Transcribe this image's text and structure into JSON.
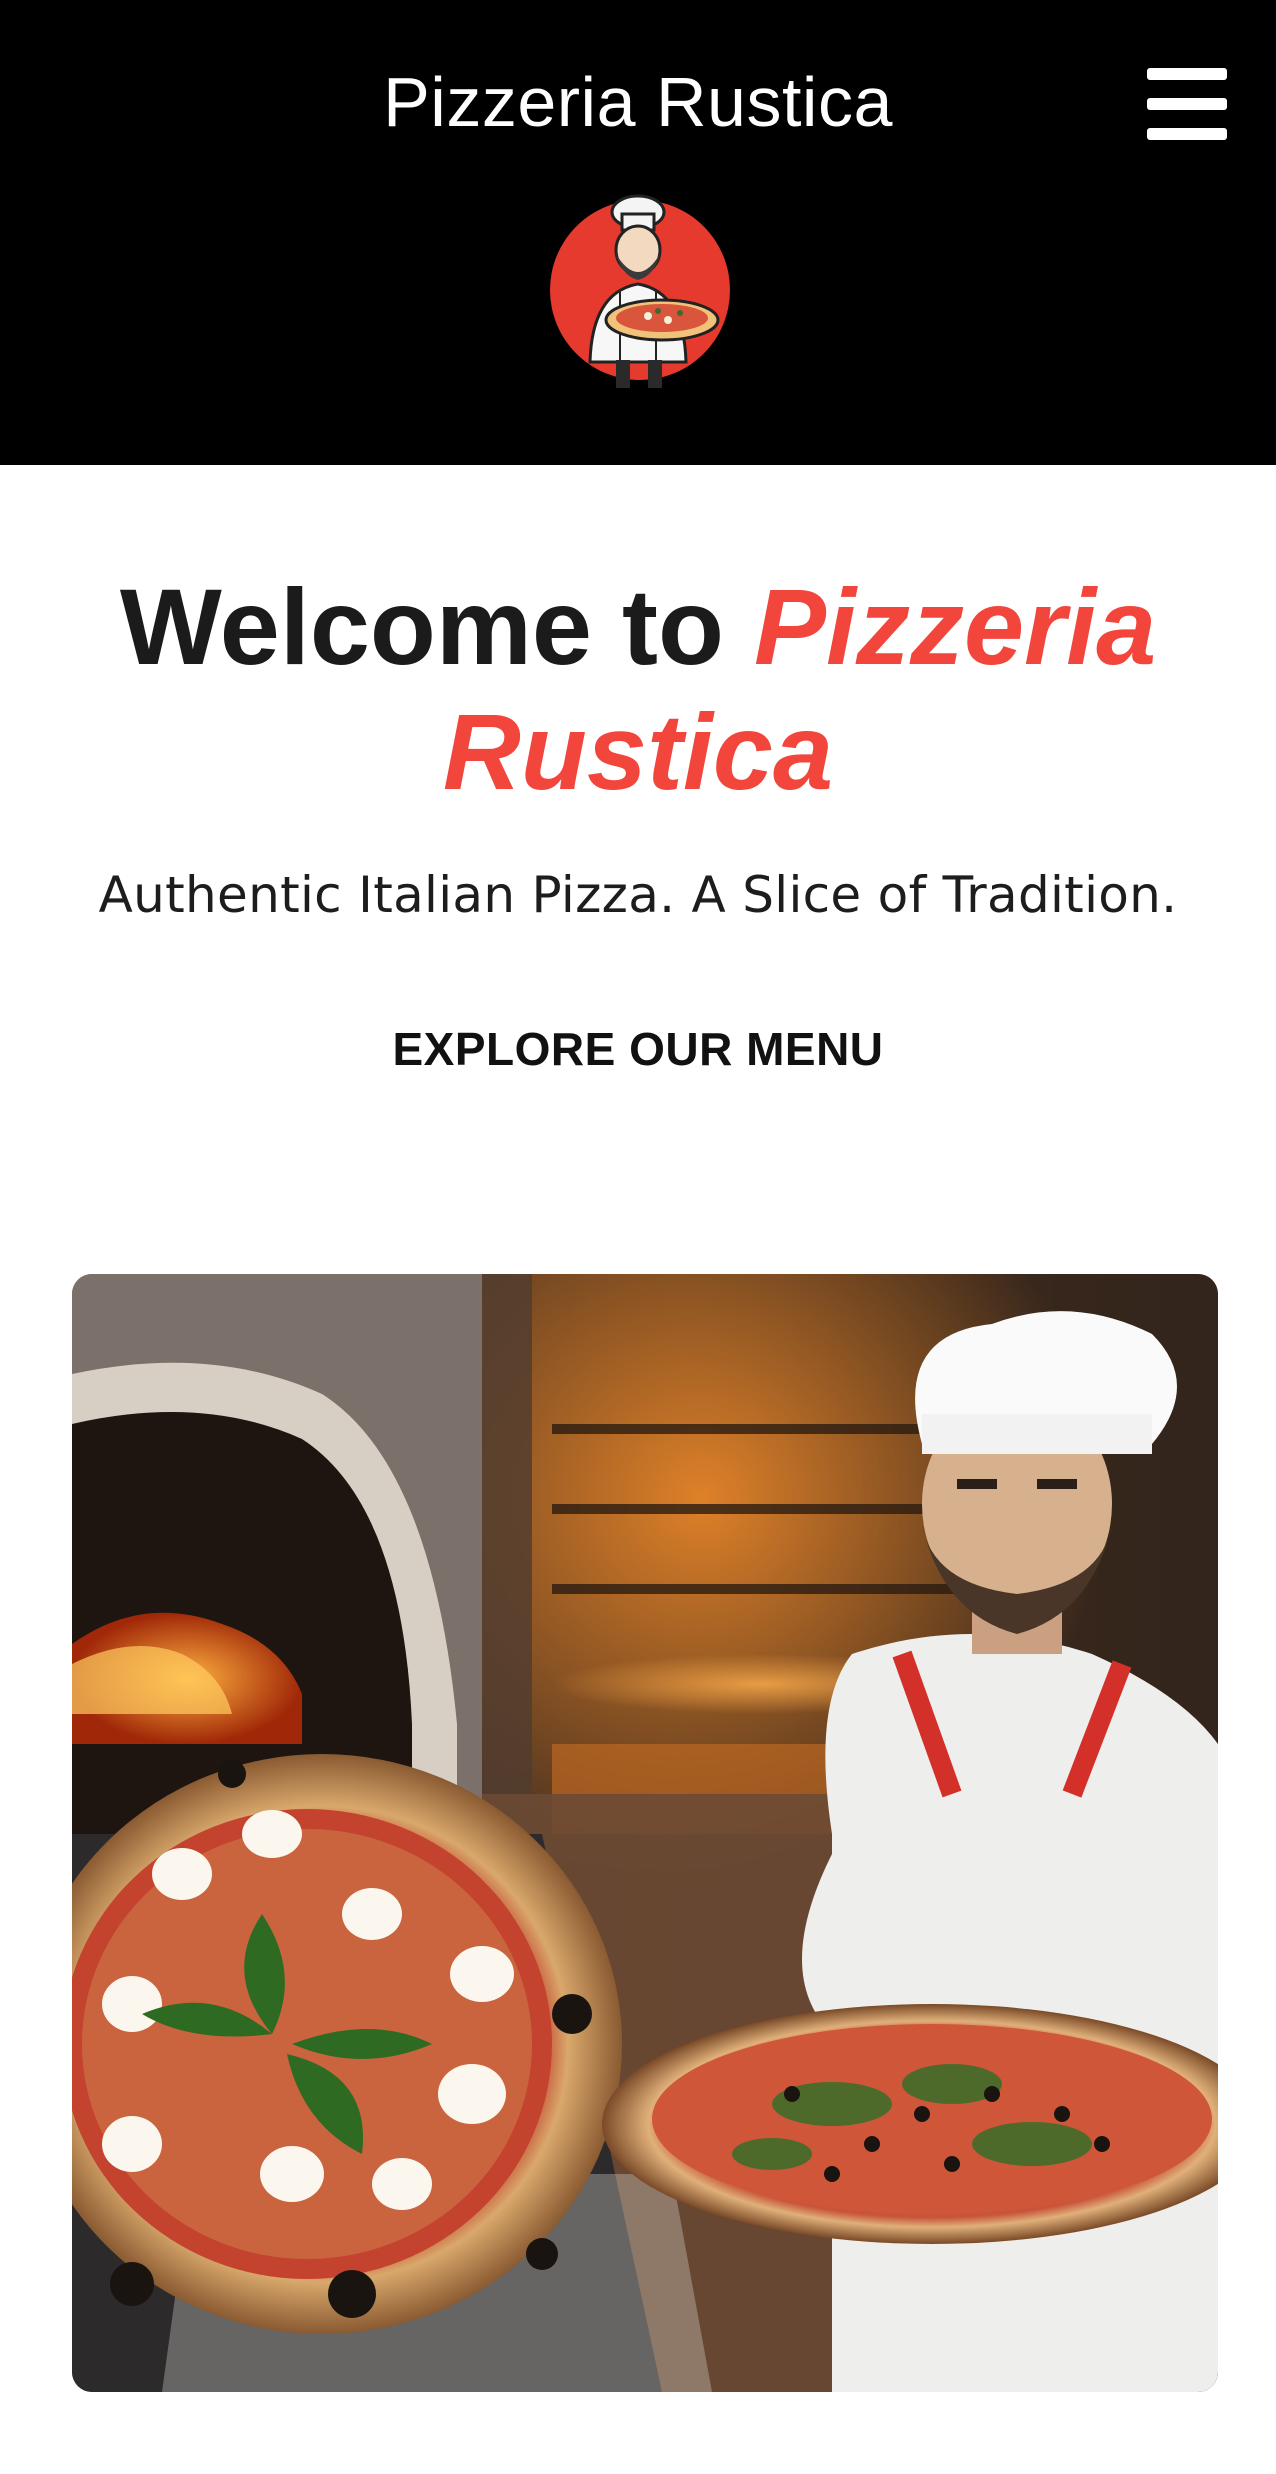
{
  "header": {
    "site_title": "Pizzeria Rustica",
    "menu_icon": "hamburger-menu-icon",
    "logo_icon": "chef-with-pizza-logo"
  },
  "hero": {
    "title_prefix": "Welcome to ",
    "title_accent": "Pizzeria Rustica",
    "tagline": "Authentic Italian Pizza. A Slice of Tradition.",
    "cta_label": "EXPLORE OUR MENU"
  },
  "colors": {
    "header_bg": "#000000",
    "accent": "#f2453c",
    "text": "#1b1b1b"
  },
  "photo": {
    "subject": "chef-holding-pizza-beside-wood-fired-oven"
  }
}
